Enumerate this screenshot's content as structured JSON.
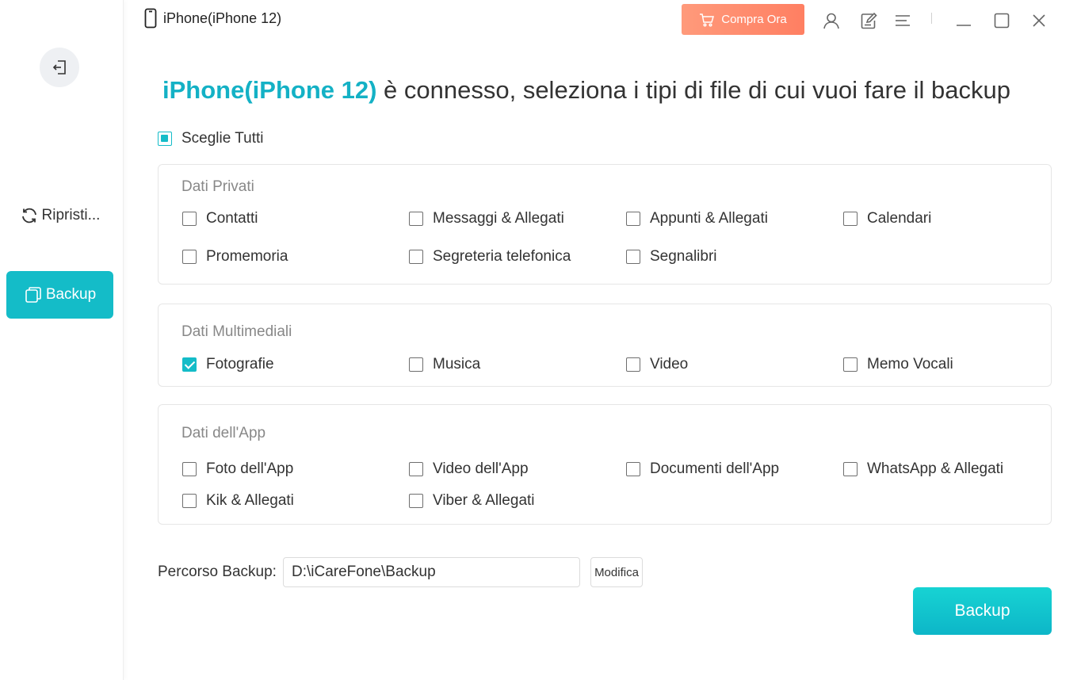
{
  "topbar": {
    "device_title": "iPhone(iPhone 12)",
    "buy_label": "Compra Ora",
    "buy_color": "#ff8c6e"
  },
  "sidebar": {
    "restore_label": "Ripristi...",
    "backup_label": "Backup",
    "active_color": "#14bcc8"
  },
  "main": {
    "headline_device": "iPhone(iPhone 12)",
    "headline_rest": " è connesso, seleziona i tipi di file di cui vuoi fare il backup",
    "select_all_label": "Sceglie Tutti",
    "select_all_state": "partial",
    "groups": [
      {
        "title": "Dati Privati",
        "options": [
          {
            "label": "Contatti",
            "checked": false
          },
          {
            "label": "Messaggi & Allegati",
            "checked": false
          },
          {
            "label": "Appunti & Allegati",
            "checked": false
          },
          {
            "label": "Calendari",
            "checked": false
          },
          {
            "label": "Promemoria",
            "checked": false
          },
          {
            "label": "Segreteria telefonica",
            "checked": false
          },
          {
            "label": "Segnalibri",
            "checked": false
          }
        ]
      },
      {
        "title": "Dati Multimediali",
        "options": [
          {
            "label": "Fotografie",
            "checked": true
          },
          {
            "label": "Musica",
            "checked": false
          },
          {
            "label": "Video",
            "checked": false
          },
          {
            "label": "Memo Vocali",
            "checked": false
          }
        ]
      },
      {
        "title": "Dati dell'App",
        "options": [
          {
            "label": "Foto dell'App",
            "checked": false
          },
          {
            "label": "Video dell'App",
            "checked": false
          },
          {
            "label": "Documenti dell'App",
            "checked": false
          },
          {
            "label": "WhatsApp & Allegati",
            "checked": false
          },
          {
            "label": "Kik & Allegati",
            "checked": false
          },
          {
            "label": "Viber & Allegati",
            "checked": false
          }
        ]
      }
    ],
    "path_label": "Percorso Backup:",
    "path_value": "D:\\iCareFone\\Backup",
    "modify_label": "Modifica",
    "backup_button_label": "Backup"
  }
}
